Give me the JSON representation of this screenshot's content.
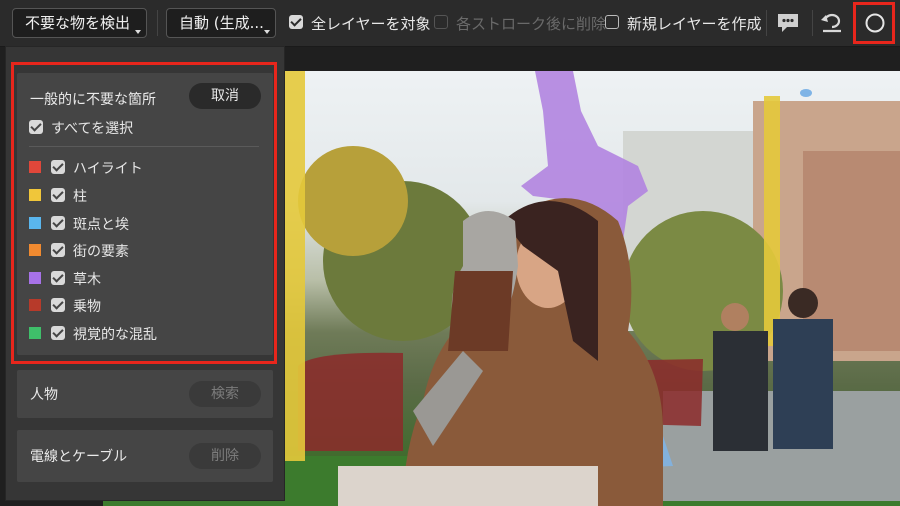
{
  "toolbar": {
    "detect_dropdown": "不要な物を検出",
    "mode_dropdown": "自動 (生成...",
    "all_layers_label": "全レイヤーを対象",
    "all_layers_checked": true,
    "delete_after_stroke_label": "各ストローク後に削除",
    "delete_after_stroke_checked": false,
    "new_layer_label": "新規レイヤーを作成",
    "new_layer_checked": false,
    "icons": [
      "feedback-icon",
      "reset-icon",
      "circle-icon"
    ]
  },
  "panel": {
    "general": {
      "title": "一般的に不要な箇所",
      "cancel_label": "取消",
      "select_all_label": "すべてを選択",
      "categories": [
        {
          "label": "ハイライト",
          "color": "#e0473a",
          "checked": true
        },
        {
          "label": "柱",
          "color": "#f0c63a",
          "checked": true
        },
        {
          "label": "斑点と埃",
          "color": "#5ab6ee",
          "checked": true
        },
        {
          "label": "街の要素",
          "color": "#f08a30",
          "checked": true
        },
        {
          "label": "草木",
          "color": "#a772e8",
          "checked": true
        },
        {
          "label": "乗物",
          "color": "#b73a2a",
          "checked": true
        },
        {
          "label": "視覚的な混乱",
          "color": "#3fbf6a",
          "checked": true
        }
      ]
    },
    "people": {
      "title": "人物",
      "button_label": "検索"
    },
    "wires": {
      "title": "電線とケーブル",
      "button_label": "削除"
    }
  }
}
